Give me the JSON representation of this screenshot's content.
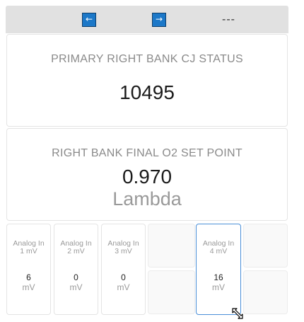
{
  "toolbar": {
    "prev_icon": "←",
    "next_icon": "→",
    "status": "---"
  },
  "cards": [
    {
      "title": "PRIMARY RIGHT BANK CJ STATUS",
      "value": "10495"
    },
    {
      "title": "RIGHT BANK FINAL O2 SET POINT",
      "value": "0.970",
      "unit": "Lambda"
    }
  ],
  "tiles": [
    {
      "label_line1": "Analog In",
      "label_line2": "1 mV",
      "value": "6",
      "unit": "mV"
    },
    {
      "label_line1": "Analog In",
      "label_line2": "2 mV",
      "value": "0",
      "unit": "mV"
    },
    {
      "label_line1": "Analog In",
      "label_line2": "3 mV",
      "value": "0",
      "unit": "mV"
    },
    {
      "label_line1": "Analog In",
      "label_line2": "4 mV",
      "value": "16",
      "unit": "mV"
    }
  ],
  "colors": {
    "toolbar_bg": "#e1e1e1",
    "nav_button": "#1c78c8",
    "active_tile_border": "#4a8fd8"
  }
}
